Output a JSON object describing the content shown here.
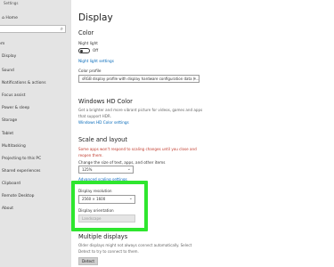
{
  "window": {
    "title": "Settings"
  },
  "sidebar": {
    "home": "Home",
    "category": "em",
    "items": [
      "Display",
      "Sound",
      "Notifications & actions",
      "Focus assist",
      "Power & sleep",
      "Storage",
      "Tablet",
      "Multitasking",
      "Projecting to this PC",
      "Shared experiences",
      "Clipboard",
      "Remote Desktop",
      "About"
    ]
  },
  "display": {
    "title": "Display",
    "color": {
      "heading": "Color",
      "night_light_label": "Night light",
      "night_light_state": "Off",
      "night_light_link": "Night light settings",
      "profile_label": "Color profile",
      "profile_value": "sRGB display profile with display hardware configuration data (l..."
    },
    "hd_color": {
      "heading": "Windows HD Color",
      "description": "Get a brighter and more vibrant picture for videos, games and apps that support HDR.",
      "link": "Windows HD Color settings"
    },
    "scale": {
      "heading": "Scale and layout",
      "warning": "Some apps won't respond to scaling changes until you close and reopen them.",
      "change_size_label": "Change the size of text, apps, and other items",
      "change_size_value": "125%",
      "advanced_link": "Advanced scaling settings",
      "resolution_label": "Display resolution",
      "resolution_value": "2560 × 1600",
      "orientation_label": "Display orientation",
      "orientation_value": "Landscape"
    },
    "multiple": {
      "heading": "Multiple displays",
      "description": "Older displays might not always connect automatically. Select Detect to try to connect to them.",
      "detect_button": "Detect"
    }
  },
  "colors": {
    "highlight": "#2ee62e",
    "link": "#0067b8",
    "warning": "#c0392b",
    "sidebar_bg": "#e4e4e4"
  }
}
